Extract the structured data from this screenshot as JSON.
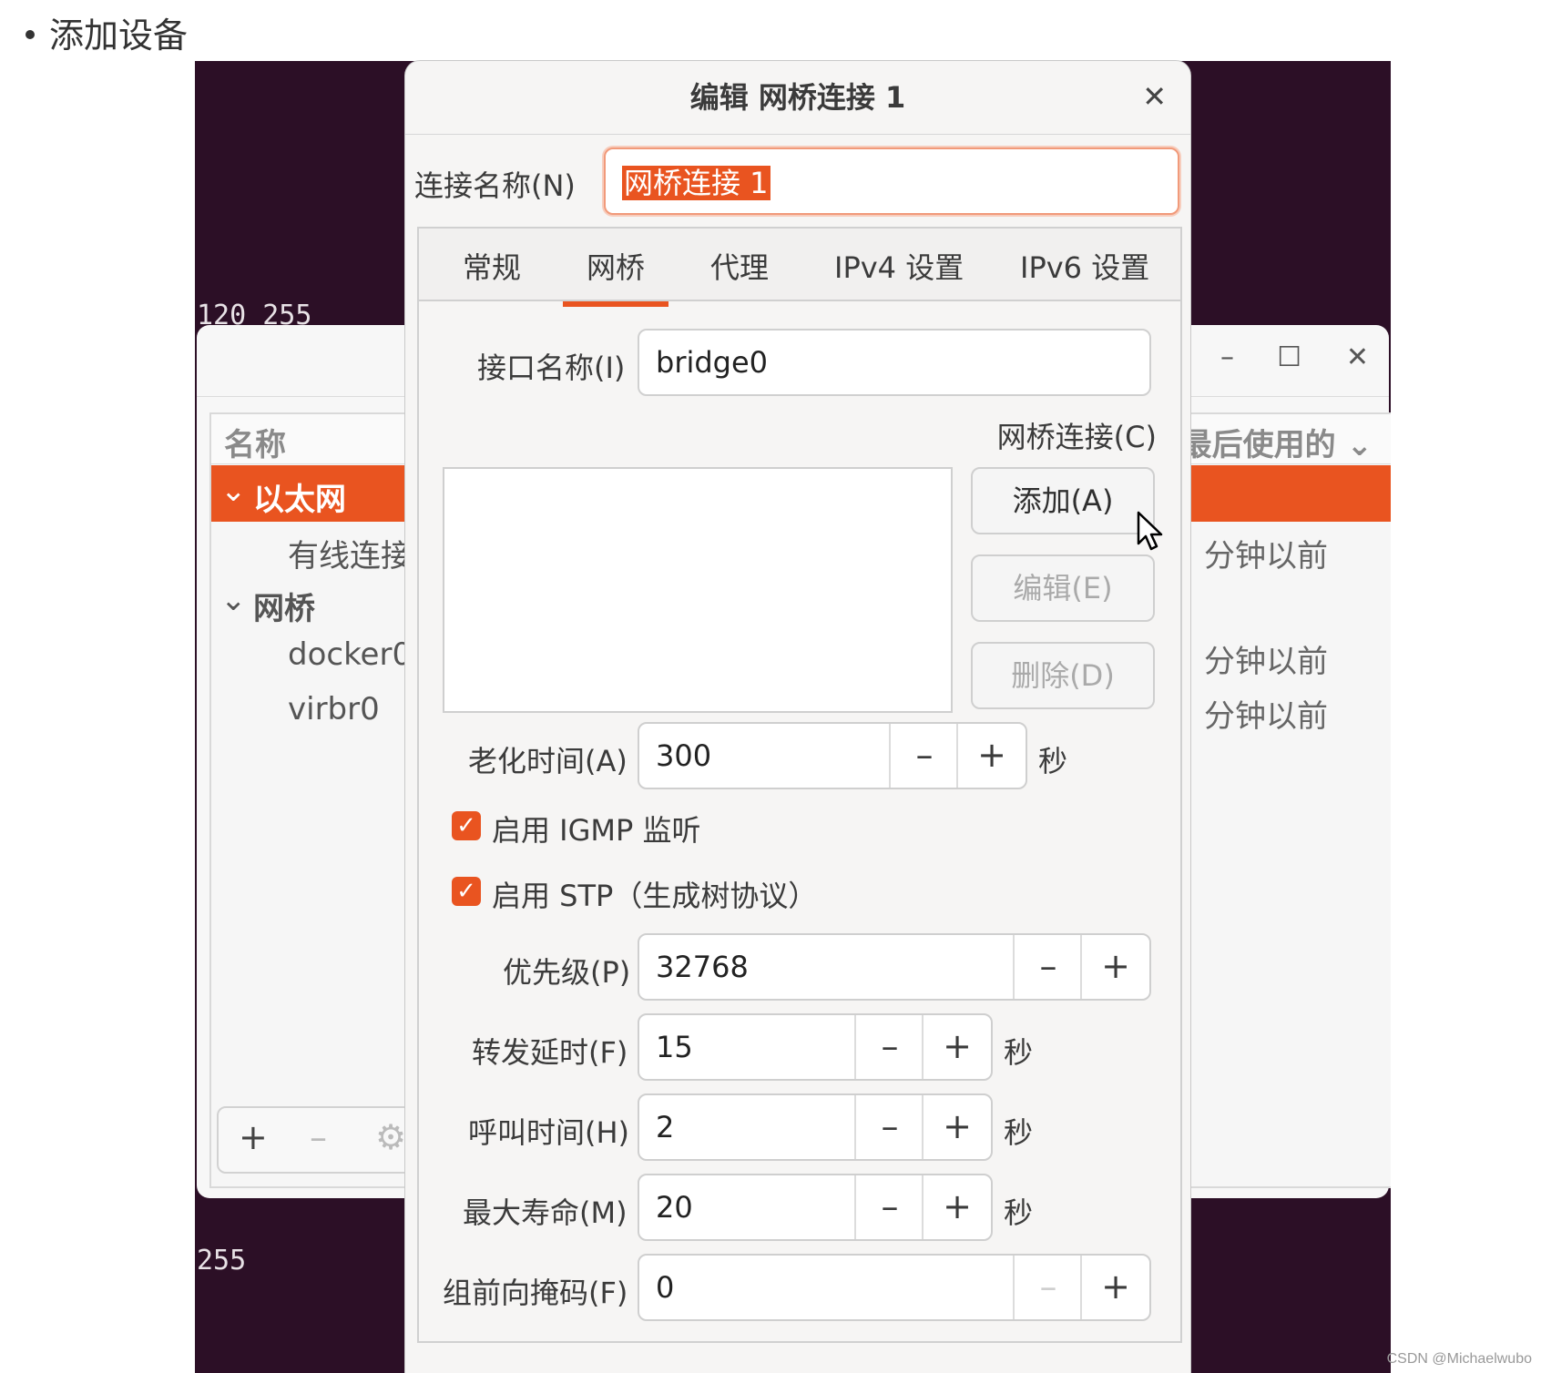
{
  "page": {
    "bullet_text": "添加设备",
    "watermark": "CSDN @Michaelwubo"
  },
  "terminal": {
    "line1": "120 255",
    "line2": "255"
  },
  "background_window": {
    "controls": {
      "minimize": "–",
      "maximize": "☐",
      "close": "✕"
    },
    "header": {
      "col_name": "名称",
      "col_last_used": "最后使用的"
    },
    "groups": [
      {
        "label": "以太网",
        "items": [
          {
            "label": "有线连接",
            "time": "分钟以前"
          }
        ]
      },
      {
        "label": "网桥",
        "items": [
          {
            "label": "docker0",
            "time": "分钟以前"
          },
          {
            "label": "virbr0",
            "time": "分钟以前"
          }
        ]
      }
    ],
    "footer": {
      "add": "+",
      "remove": "–",
      "settings": "⚙"
    }
  },
  "dialog": {
    "title": "编辑 网桥连接 1",
    "close": "✕",
    "connection_name_label": "连接名称(N)",
    "connection_name_value": "网桥连接 1",
    "tabs": [
      "常规",
      "网桥",
      "代理",
      "IPv4 设置",
      "IPv6 设置"
    ],
    "active_tab": "网桥",
    "interface_label": "接口名称(I)",
    "interface_value": "bridge0",
    "bridge_connections_label": "网桥连接(C)",
    "buttons": {
      "add": "添加(A)",
      "edit": "编辑(E)",
      "delete": "删除(D)"
    },
    "aging": {
      "label": "老化时间(A)",
      "value": "300",
      "unit": "秒"
    },
    "igmp": {
      "label": "启用 IGMP 监听",
      "checked": true
    },
    "stp": {
      "label": "启用 STP（生成树协议）",
      "checked": true
    },
    "priority": {
      "label": "优先级(P)",
      "value": "32768"
    },
    "forward_delay": {
      "label": "转发延时(F)",
      "value": "15",
      "unit": "秒"
    },
    "hello_time": {
      "label": "呼叫时间(H)",
      "value": "2",
      "unit": "秒"
    },
    "max_age": {
      "label": "最大寿命(M)",
      "value": "20",
      "unit": "秒"
    },
    "group_mask": {
      "label": "组前向掩码(F)",
      "value": "0"
    },
    "spin": {
      "minus": "–",
      "plus": "+"
    },
    "check_glyph": "✓"
  },
  "colors": {
    "accent": "#e95420",
    "desktop": "#2c0f26"
  }
}
